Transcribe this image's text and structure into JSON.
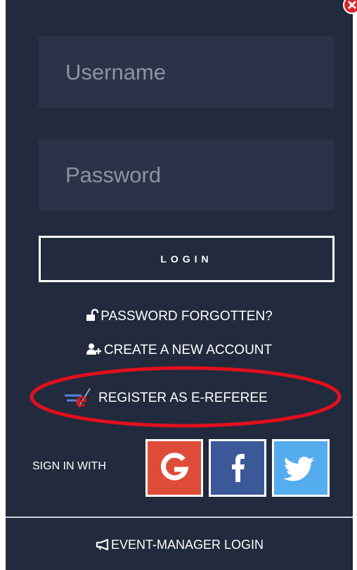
{
  "login_form": {
    "username_placeholder": "Username",
    "password_placeholder": "Password",
    "login_label": "LOGIN"
  },
  "links": {
    "password_forgotten": "PASSWORD FORGOTTEN?",
    "create_account": "CREATE A NEW ACCOUNT",
    "register_ereferee": "REGISTER AS E-REFEREE",
    "event_manager_login": "EVENT-MANAGER LOGIN"
  },
  "social": {
    "label": "SIGN IN WITH",
    "providers": [
      "google",
      "facebook",
      "twitter"
    ]
  },
  "icons": {
    "close": "close-icon",
    "password_forgotten": "unlock-icon",
    "create_account": "user-plus-icon",
    "register_ereferee": "e-referee-logo",
    "google": "google-icon",
    "facebook": "facebook-icon",
    "twitter": "twitter-icon",
    "event_manager": "megaphone-icon"
  },
  "colors": {
    "panel_background": "#222a3d",
    "input_background": "#2b3348",
    "google": "#de4b39",
    "facebook": "#3b5998",
    "twitter": "#55acee",
    "highlight_ring": "#e0101e",
    "close_button": "#d9262b"
  }
}
